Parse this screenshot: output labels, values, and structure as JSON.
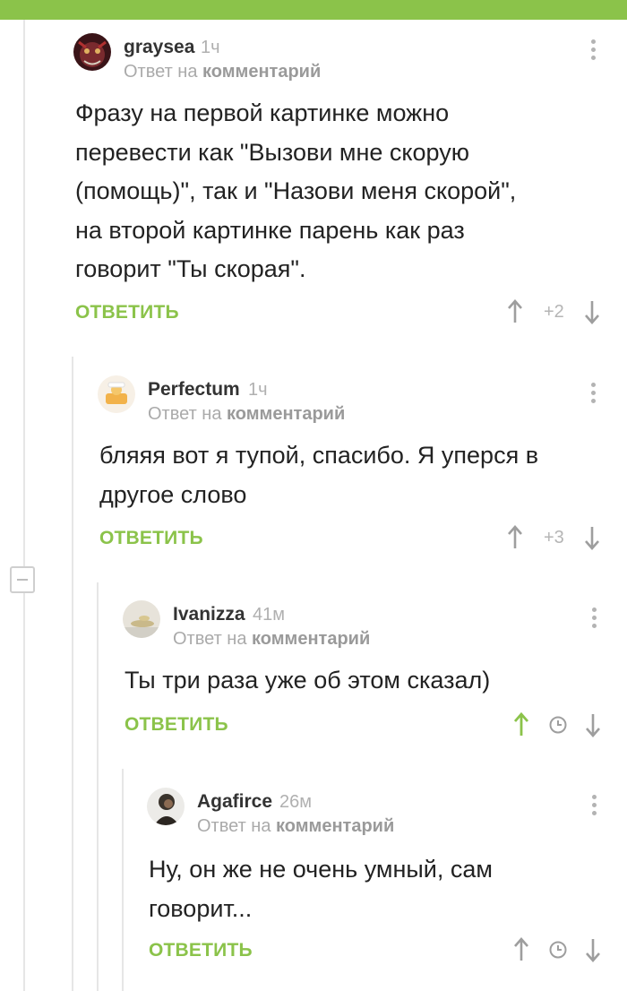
{
  "colors": {
    "accent": "#8bc34a",
    "meta": "#aaaaaa",
    "text": "#222222"
  },
  "comments": [
    {
      "author": "graysea",
      "time": "1ч",
      "reply_prefix": "Ответ на",
      "reply_target": "комментарий",
      "text": "Фразу на первой картинке можно перевести как \"Вызови мне скорую (помощь)\", так и \"Назови меня скорой\", на второй картинке парень как раз говорит \"Ты скорая\".",
      "reply_label": "ОТВЕТИТЬ",
      "score": "+2"
    },
    {
      "author": "Perfectum",
      "time": "1ч",
      "reply_prefix": "Ответ на",
      "reply_target": "комментарий",
      "text": "бляяя вот я тупой, спасибо. Я уперся в другое слово",
      "reply_label": "ОТВЕТИТЬ",
      "score": "+3"
    },
    {
      "author": "Ivanizza",
      "time": "41м",
      "reply_prefix": "Ответ на",
      "reply_target": "комментарий",
      "text": "Ты три раза уже об этом сказал)",
      "reply_label": "ОТВЕТИТЬ",
      "score": ""
    },
    {
      "author": "Agafirce",
      "time": "26м",
      "reply_prefix": "Ответ на",
      "reply_target": "комментарий",
      "text": "Ну, он же не очень умный, сам говорит...",
      "reply_label": "ОТВЕТИТЬ",
      "score": ""
    }
  ],
  "icons": {
    "upvote": "arrow-up-icon",
    "downvote": "arrow-down-icon",
    "timer": "clock-icon",
    "menu": "more-vertical-icon",
    "collapse": "minus-icon"
  }
}
